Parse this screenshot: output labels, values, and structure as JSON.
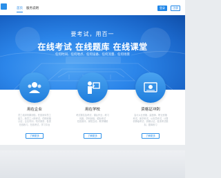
{
  "header": {
    "logo_text": "",
    "nav": [
      "首页",
      "服务说明"
    ],
    "login_label": "登录",
    "register_label": "注册"
  },
  "hero": {
    "subtitle": "要考试，用百一",
    "headline": "在线考试  在线题库  在线课堂",
    "tags": "任何时间、任何地点、任何设备、任何流量、任何场景"
  },
  "cards": [
    {
      "icon": "users-icon",
      "title": "用在企业",
      "desc": [
        "员工培训效果测验，在线测评员工",
        "能力，新员工入职考试，任职资格",
        "认证，企业内训，知识竞赛，各类",
        "在线练习，在线考试，学习平台"
      ],
      "button": "了解更多"
    },
    {
      "icon": "teacher-icon",
      "title": "用在学校",
      "desc": [
        "考试报名及考试，课后作业，练习",
        "巩固，学科测验，模拟考试",
        "在线测评，家校互动，教学辅助"
      ],
      "button": "了解更多"
    },
    {
      "icon": "certificate-icon",
      "title": "资格证冲刺",
      "desc": [
        "会计从业资格，建造师，职业资格",
        "考试，医学考试，公务员考试，计算",
        "机等级考试，资格认证，各类考试模",
        "拟，题库练习"
      ],
      "button": "了解更多"
    }
  ],
  "colors": {
    "primary": "#1f86e8",
    "hero_dark": "#0f4ea8"
  }
}
